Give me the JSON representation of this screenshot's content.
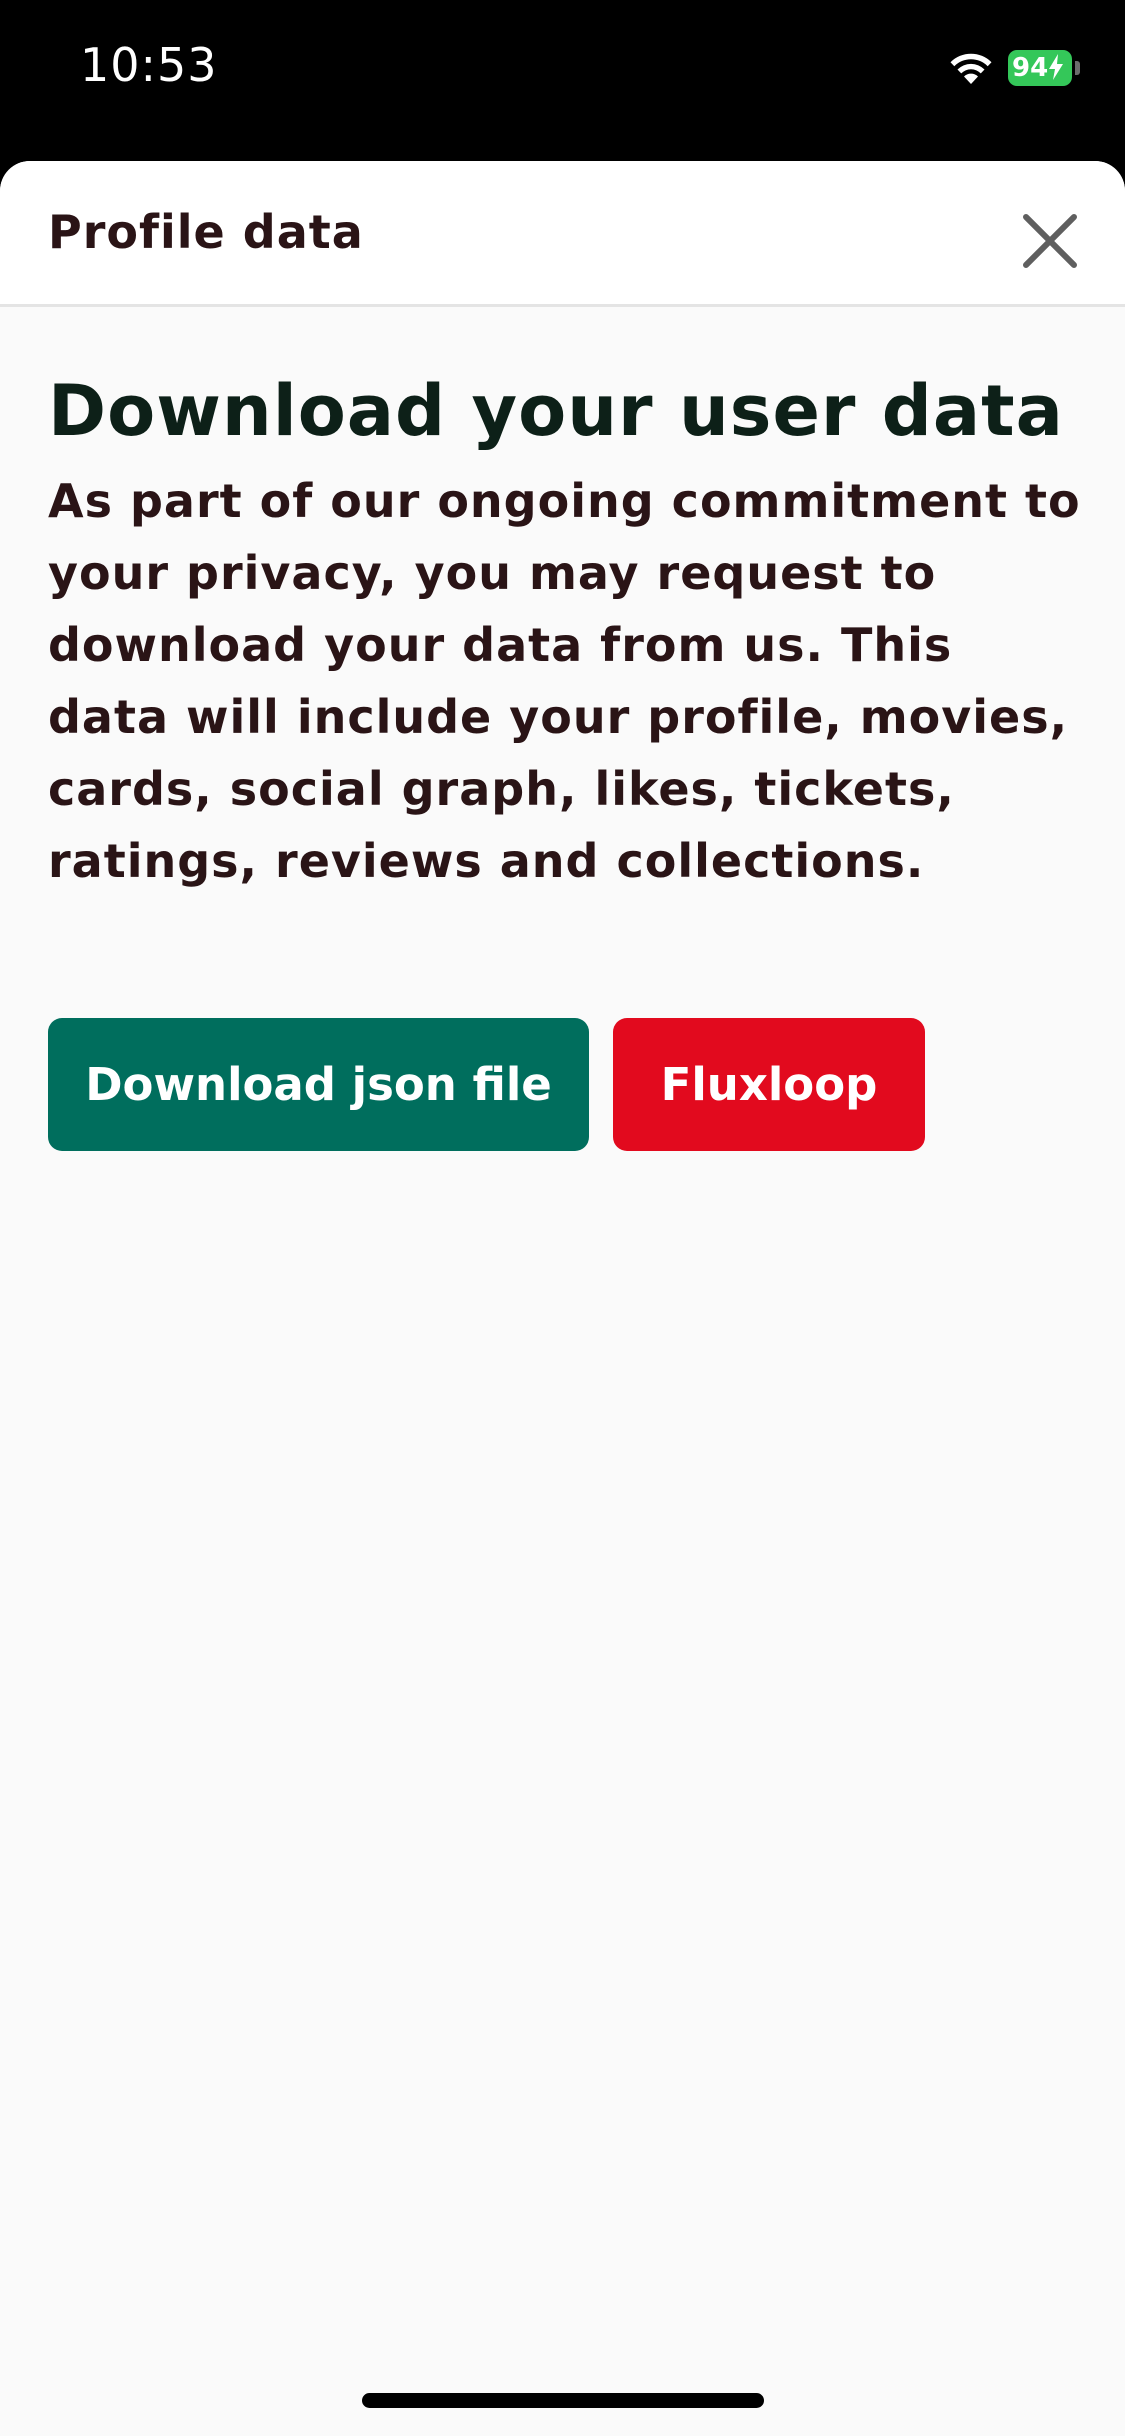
{
  "status_bar": {
    "time": "10:53",
    "battery_level": "94",
    "battery_color": "#34c759",
    "wifi_icon": "wifi-icon",
    "charging_icon": "bolt-icon"
  },
  "header": {
    "title": "Profile data",
    "close_icon": "close-icon"
  },
  "main": {
    "heading": "Download your user data",
    "description": "As part of our ongoing commitment to your privacy, you may request to download your data from us. This data will include your profile, movies, cards, social graph, likes, tickets, ratings, reviews and collections."
  },
  "actions": {
    "download_label": "Download json file",
    "brand_label": "Fluxloop",
    "download_color": "#006e5d",
    "brand_color": "#e20a1e"
  }
}
